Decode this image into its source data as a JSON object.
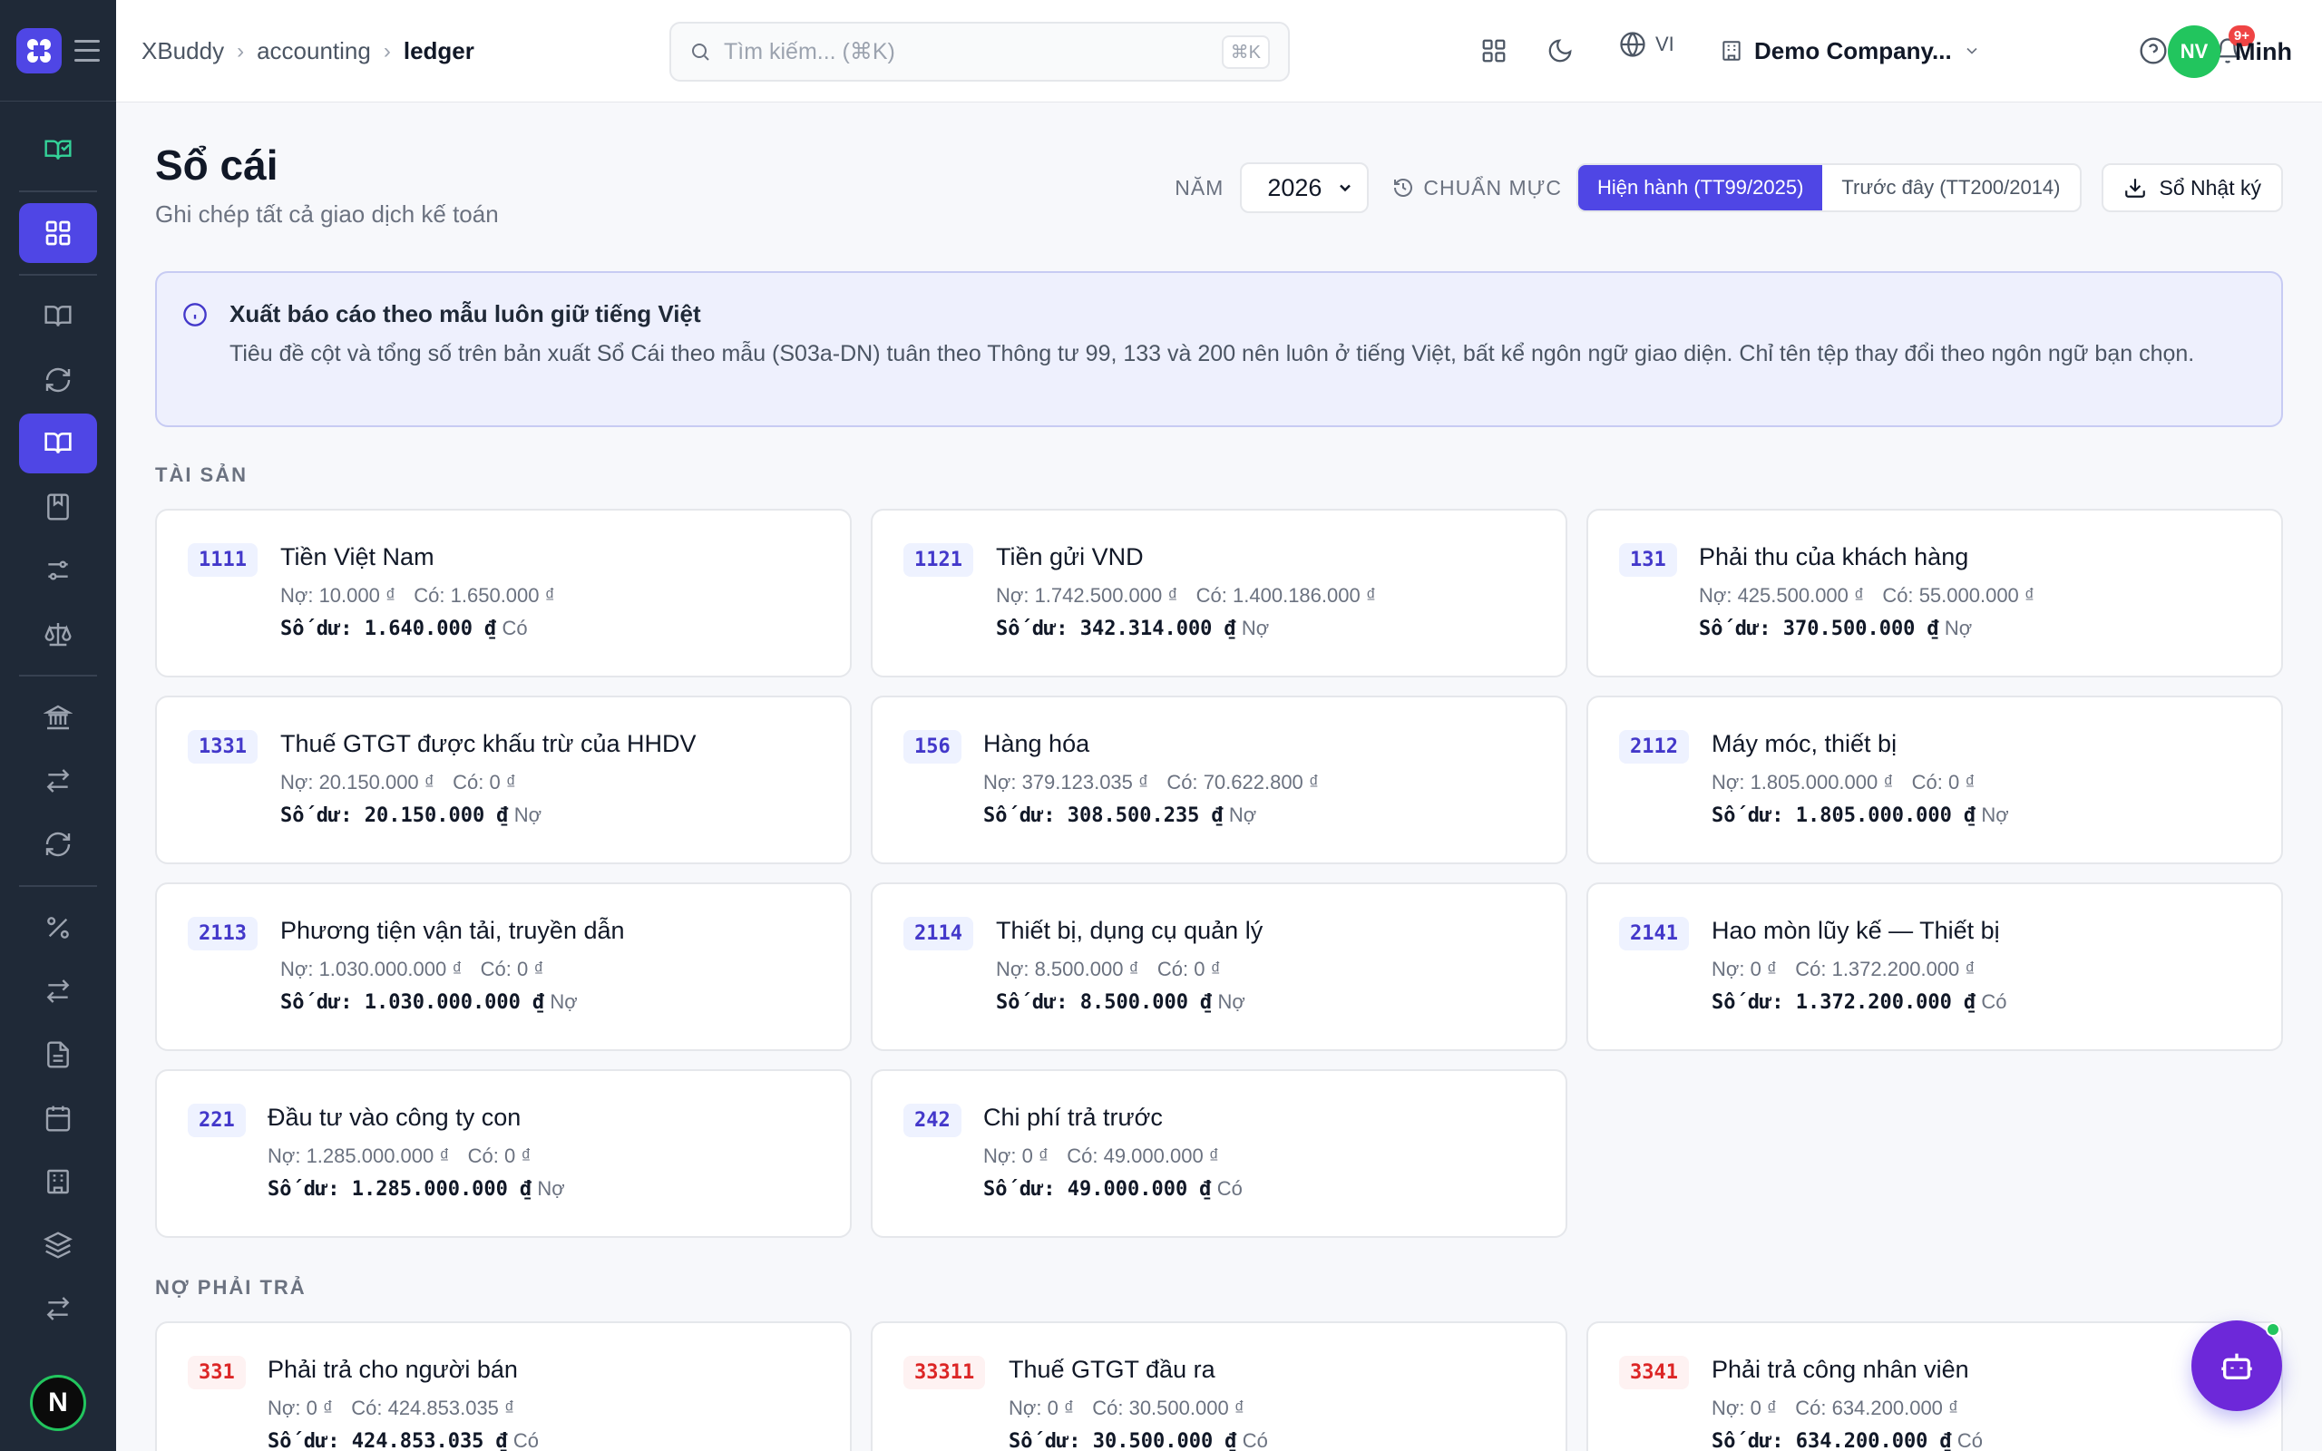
{
  "header": {
    "breadcrumb": [
      "XBuddy",
      "accounting",
      "ledger"
    ],
    "search_placeholder": "Tìm kiếm... (⌘K)",
    "search_shortcut": "⌘K",
    "language": "VI",
    "company": "Demo Company...",
    "notification_badge": "9+",
    "user_initials": "NV",
    "user_name": "Minh"
  },
  "sidebar": {
    "avatar_letter": "N"
  },
  "page": {
    "title": "Sổ cái",
    "subtitle": "Ghi chép tất cả giao dịch kế toán",
    "year_label": "NĂM",
    "year_value": "2026",
    "standard_label": "CHUẨN MỰC",
    "standard_current": "Hiện hành (TT99/2025)",
    "standard_previous": "Trước đây (TT200/2014)",
    "export_label": "Sổ Nhật ký"
  },
  "info": {
    "title": "Xuất báo cáo theo mẫu luôn giữ tiếng Việt",
    "text": "Tiêu đề cột và tổng số trên bản xuất Sổ Cái theo mẫu (S03a-DN) tuân theo Thông tư 99, 133 và 200 nên luôn ở tiếng Việt, bất kể ngôn ngữ giao diện. Chỉ tên tệp thay đổi theo ngôn ngữ bạn chọn."
  },
  "sections": {
    "assets": "TÀI SẢN",
    "liabilities": "NỢ PHẢI TRẢ"
  },
  "labels": {
    "debit": "Nợ:",
    "credit": "Có:",
    "balance": "Số dư:"
  },
  "asset_accounts": [
    {
      "code": "1111",
      "name": "Tiền Việt Nam",
      "debit": "10.000 ₫",
      "credit": "1.650.000 ₫",
      "balance": "1.640.000 ₫",
      "side": "Có"
    },
    {
      "code": "1121",
      "name": "Tiền gửi VND",
      "debit": "1.742.500.000 ₫",
      "credit": "1.400.186.000 ₫",
      "balance": "342.314.000 ₫",
      "side": "Nợ"
    },
    {
      "code": "131",
      "name": "Phải thu của khách hàng",
      "debit": "425.500.000 ₫",
      "credit": "55.000.000 ₫",
      "balance": "370.500.000 ₫",
      "side": "Nợ"
    },
    {
      "code": "1331",
      "name": "Thuế GTGT được khấu trừ của HHDV",
      "debit": "20.150.000 ₫",
      "credit": "0 ₫",
      "balance": "20.150.000 ₫",
      "side": "Nợ"
    },
    {
      "code": "156",
      "name": "Hàng hóa",
      "debit": "379.123.035 ₫",
      "credit": "70.622.800 ₫",
      "balance": "308.500.235 ₫",
      "side": "Nợ"
    },
    {
      "code": "2112",
      "name": "Máy móc, thiết bị",
      "debit": "1.805.000.000 ₫",
      "credit": "0 ₫",
      "balance": "1.805.000.000 ₫",
      "side": "Nợ"
    },
    {
      "code": "2113",
      "name": "Phương tiện vận tải, truyền dẫn",
      "debit": "1.030.000.000 ₫",
      "credit": "0 ₫",
      "balance": "1.030.000.000 ₫",
      "side": "Nợ"
    },
    {
      "code": "2114",
      "name": "Thiết bị, dụng cụ quản lý",
      "debit": "8.500.000 ₫",
      "credit": "0 ₫",
      "balance": "8.500.000 ₫",
      "side": "Nợ"
    },
    {
      "code": "2141",
      "name": "Hao mòn lũy kế — Thiết bị",
      "debit": "0 ₫",
      "credit": "1.372.200.000 ₫",
      "balance": "1.372.200.000 ₫",
      "side": "Có"
    },
    {
      "code": "221",
      "name": "Đầu tư vào công ty con",
      "debit": "1.285.000.000 ₫",
      "credit": "0 ₫",
      "balance": "1.285.000.000 ₫",
      "side": "Nợ"
    },
    {
      "code": "242",
      "name": "Chi phí trả trước",
      "debit": "0 ₫",
      "credit": "49.000.000 ₫",
      "balance": "49.000.000 ₫",
      "side": "Có"
    }
  ],
  "liability_accounts": [
    {
      "code": "331",
      "name": "Phải trả cho người bán",
      "debit": "0 ₫",
      "credit": "424.853.035 ₫",
      "balance": "424.853.035 ₫",
      "side": "Có"
    },
    {
      "code": "33311",
      "name": "Thuế GTGT đầu ra",
      "debit": "0 ₫",
      "credit": "30.500.000 ₫",
      "balance": "30.500.000 ₫",
      "side": "Có"
    },
    {
      "code": "3341",
      "name": "Phải trả công nhân viên",
      "debit": "0 ₫",
      "credit": "634.200.000 ₫",
      "balance": "634.200.000 ₫",
      "side": "Có"
    }
  ]
}
